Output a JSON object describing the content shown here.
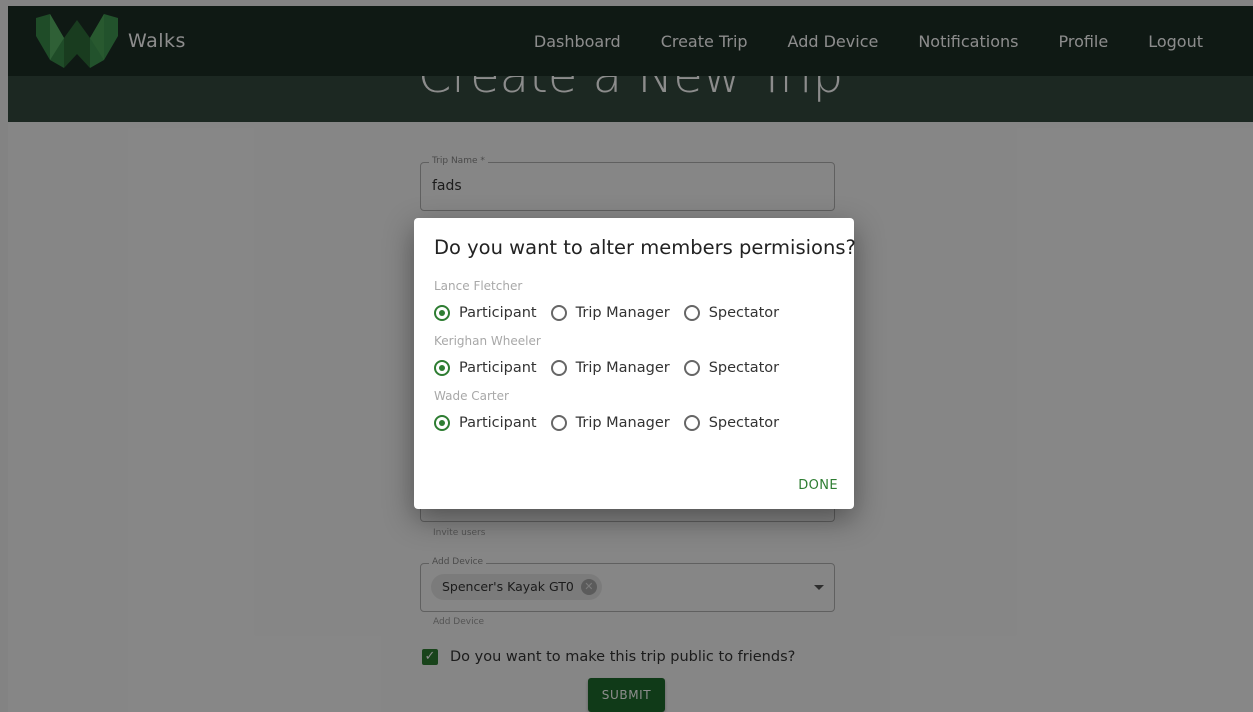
{
  "app": {
    "brand": "Walks"
  },
  "nav": {
    "links": [
      "Dashboard",
      "Create Trip",
      "Add Device",
      "Notifications",
      "Profile",
      "Logout"
    ]
  },
  "page": {
    "title": "Create a New Trip"
  },
  "form": {
    "trip_name": {
      "label": "Trip Name *",
      "value": "fads"
    },
    "invite_users": {
      "helper": "Invite users"
    },
    "add_device": {
      "label": "Add Device",
      "chip": "Spencer's Kayak GT0",
      "helper": "Add Device"
    },
    "public_checkbox": {
      "label": "Do you want to make this trip public to friends?",
      "checked": true
    },
    "submit_label": "SUBMIT"
  },
  "dialog": {
    "title": "Do you want to alter members permisions?",
    "options": [
      "Participant",
      "Trip Manager",
      "Spectator"
    ],
    "members": [
      {
        "name": "Lance Fletcher",
        "selected": "Participant"
      },
      {
        "name": "Kerighan Wheeler",
        "selected": "Participant"
      },
      {
        "name": "Wade Carter",
        "selected": "Participant"
      }
    ],
    "done_label": "DONE"
  },
  "colors": {
    "navbar": "#1c2e26",
    "hero": "#334a3f",
    "accent_green": "#2e7d32",
    "submit_green": "#1e6b2c"
  },
  "icons": {
    "logo": "walks-logo",
    "chip_remove": "cancel-circle-icon",
    "dropdown": "arrow-drop-down-icon",
    "checkbox": "check-icon"
  }
}
